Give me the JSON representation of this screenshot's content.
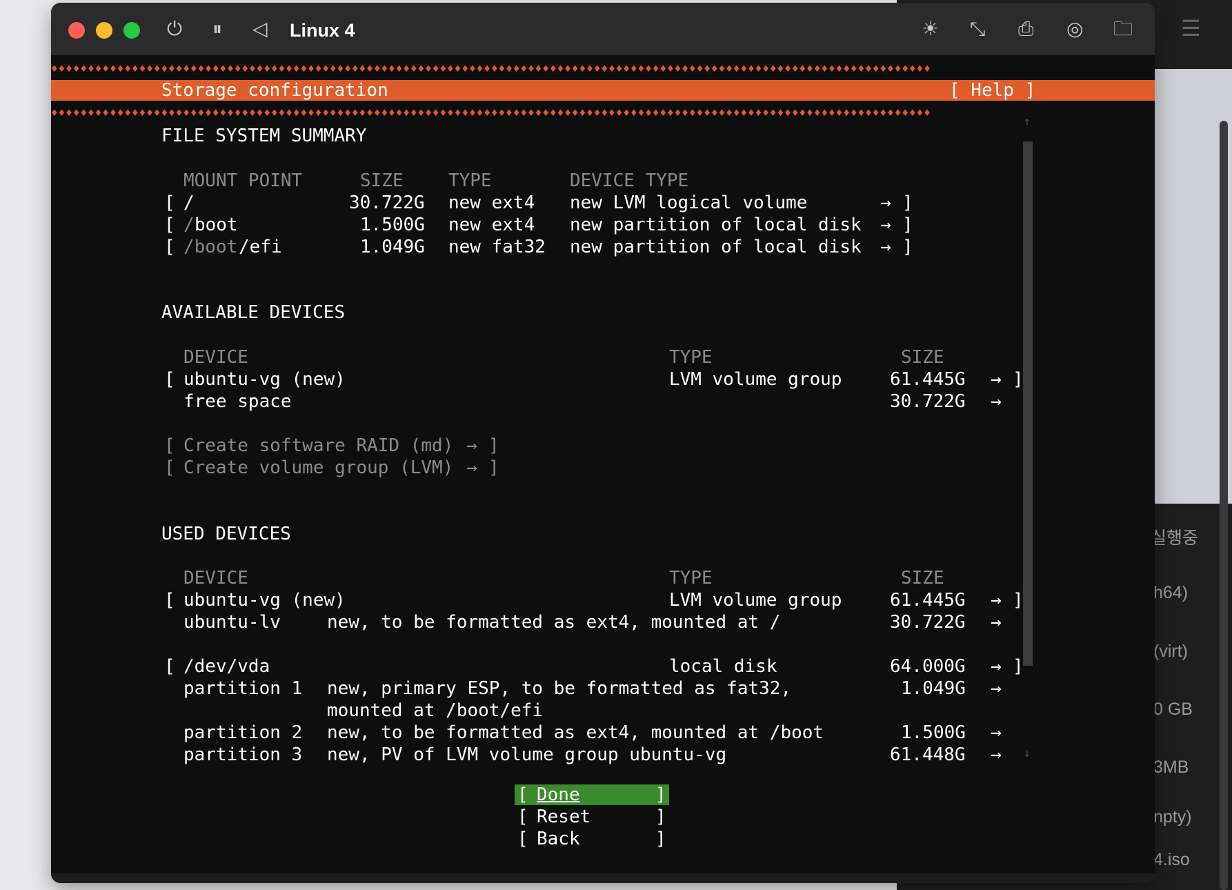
{
  "background_app": {
    "items": [
      "실행중",
      "h64)",
      "(virt)",
      "0 GB",
      "3MB",
      "npty)",
      "4.iso"
    ]
  },
  "window": {
    "title": "Linux 4",
    "buttons": {
      "power": "⏻",
      "pause": "⏸",
      "back": "◁"
    },
    "tools": {
      "brightness": "☀",
      "resize": "⤡",
      "usb": "⎙",
      "disc": "◎",
      "folder": "🗀"
    }
  },
  "screen": {
    "header": {
      "title": "Storage configuration",
      "help": "[ Help ]"
    },
    "fs_summary": {
      "title": "FILE SYSTEM SUMMARY",
      "columns": [
        "MOUNT POINT",
        "SIZE",
        "TYPE",
        "DEVICE TYPE"
      ],
      "rows": [
        {
          "mount_prefix": "",
          "mount": "/",
          "size": "30.722G",
          "type": "new ext4",
          "device_type": "new LVM logical volume"
        },
        {
          "mount_prefix": "/",
          "mount": "boot",
          "size": "1.500G",
          "type": "new ext4",
          "device_type": "new partition of local disk"
        },
        {
          "mount_prefix": "/boot",
          "mount": "/efi",
          "size": "1.049G",
          "type": "new fat32",
          "device_type": "new partition of local disk"
        }
      ]
    },
    "available": {
      "title": "AVAILABLE DEVICES",
      "columns": [
        "DEVICE",
        "TYPE",
        "SIZE"
      ],
      "vg": {
        "device": "ubuntu-vg (new)",
        "type": "LVM volume group",
        "size": "61.445G"
      },
      "free": {
        "device": "free space",
        "size": "30.722G"
      },
      "actions": [
        "Create software RAID (md)",
        "Create volume group (LVM)"
      ]
    },
    "used": {
      "title": "USED DEVICES",
      "columns": [
        "DEVICE",
        "TYPE",
        "SIZE"
      ],
      "vg": {
        "device": "ubuntu-vg (new)",
        "type": "LVM volume group",
        "size": "61.445G"
      },
      "lv": {
        "device": "ubuntu-lv",
        "desc": "new, to be formatted as ext4, mounted at /",
        "size": "30.722G"
      },
      "disk": {
        "device": "/dev/vda",
        "type": "local disk",
        "size": "64.000G"
      },
      "partitions": [
        {
          "name": "partition 1",
          "desc": "new, primary ESP, to be formatted as fat32,",
          "desc2": "mounted at /boot/efi",
          "size": "1.049G"
        },
        {
          "name": "partition 2",
          "desc": "new, to be formatted as ext4, mounted at /boot",
          "size": "1.500G"
        },
        {
          "name": "partition 3",
          "desc": "new, PV of LVM volume group ubuntu-vg",
          "size": "61.448G"
        }
      ]
    },
    "buttons": {
      "done": "Done",
      "reset": "Reset",
      "back": "Back"
    },
    "glyphs": {
      "open": "[",
      "close": "]",
      "arrow": "→",
      "diamonds": "♦♦♦♦♦♦♦♦♦♦♦♦♦♦♦♦♦♦♦♦♦♦♦♦♦♦♦♦♦♦♦♦♦♦♦♦♦♦♦♦♦♦♦♦♦♦♦♦♦♦♦♦♦♦♦♦♦♦♦♦♦♦♦♦♦♦♦♦♦♦♦♦♦♦♦♦♦♦♦♦♦♦♦♦♦♦♦♦♦♦♦♦♦♦♦♦♦♦♦♦♦♦♦♦♦♦♦♦♦♦♦♦♦♦♦♦♦♦♦♦",
      "up": "↑",
      "down": "↓"
    }
  },
  "colors": {
    "accent": "#df5d2b",
    "selected": "#3b8a2c"
  }
}
